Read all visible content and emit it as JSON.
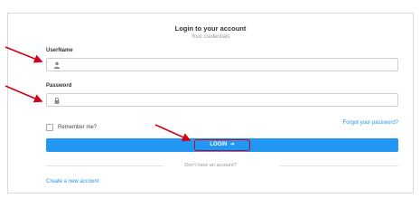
{
  "login": {
    "title": "Login to your account",
    "subtitle": "Your credentials",
    "username_label": "UserName",
    "username_value": "",
    "password_label": "Password",
    "password_value": "",
    "remember_label": "Remember me?",
    "forgot_link": "Forgot your password?",
    "login_button": "LOGIN",
    "no_account_text": "Don't have an account?",
    "create_account_link": "Create a new account"
  },
  "icons": {
    "username_icon": "user-icon",
    "password_icon": "lock-icon",
    "login_icon": "sign-in-arrow-icon"
  },
  "colors": {
    "accent": "#2196f3",
    "annotation": "#d0021b"
  }
}
